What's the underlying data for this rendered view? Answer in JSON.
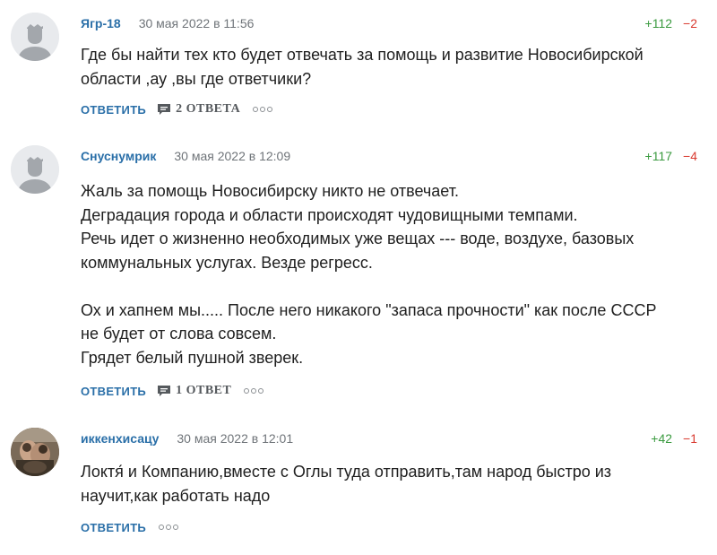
{
  "comments": [
    {
      "author": "Ягр-18",
      "date": "30 мая 2022 в 11:56",
      "votes_up": "+112",
      "votes_down": "−2",
      "avatar_icon": "default-user-icon",
      "lines": [
        "Где бы найти тех кто будет отвечать за помощь и развитие Новосибирской",
        "области ,ау ,вы где ответчики?"
      ],
      "reply_label": "ОТВЕТИТЬ",
      "replies_label": "2 ОТВЕТА"
    },
    {
      "author": "Снуснумрик",
      "date": "30 мая 2022 в 12:09",
      "votes_up": "+117",
      "votes_down": "−4",
      "avatar_icon": "default-user-icon",
      "lines": [
        "Жаль за помощь Новосибирску никто не отвечает.",
        "Деградация города и области происходят чудовищными темпами.",
        "Речь идет о жизненно необходимых уже вещах --- воде, воздухе, базовых",
        "коммунальных услугах. Везде регресс.",
        "",
        "Ох и хапнем мы..... После него никакого \"запаса прочности\" как после СССР",
        "не будет от слова совсем.",
        "Грядет белый пушной зверек."
      ],
      "reply_label": "ОТВЕТИТЬ",
      "replies_label": "1 ОТВЕТ"
    },
    {
      "author": "иккенхисацу",
      "date": "30 мая 2022 в 12:01",
      "votes_up": "+42",
      "votes_down": "−1",
      "avatar_icon": "user-photo",
      "lines": [
        "Локтя́ и Компанию,вместе с Оглы туда отправить,там народ быстро из",
        "научит,как работать надо"
      ],
      "reply_label": "ОТВЕТИТЬ"
    }
  ],
  "colors": {
    "link": "#2a6fa8",
    "vote_up": "#3a9a3f",
    "vote_down": "#d9392f",
    "meta": "#6f7479"
  }
}
